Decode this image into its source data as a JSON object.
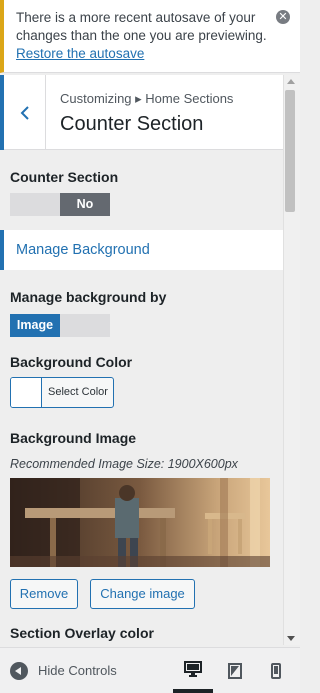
{
  "notice": {
    "text": "There is a more recent autosave of your changes than the one you are previewing.",
    "link": "Restore the autosave"
  },
  "header": {
    "breadcrumb": "Customizing ▸ Home Sections",
    "title": "Counter Section"
  },
  "controls": {
    "counter_section": {
      "label": "Counter Section",
      "value": "No"
    },
    "manage_background_panel": "Manage Background",
    "manage_background_by": {
      "label": "Manage background by",
      "value": "Image"
    },
    "background_color": {
      "label": "Background Color",
      "button": "Select Color"
    },
    "background_image": {
      "label": "Background Image",
      "hint": "Recommended Image Size: 1900X600px",
      "remove": "Remove",
      "change": "Change image"
    },
    "section_overlay": {
      "label": "Section Overlay color"
    }
  },
  "footer": {
    "hide_controls": "Hide Controls",
    "devices": [
      "desktop",
      "tablet",
      "mobile"
    ],
    "active_device": "desktop"
  },
  "colors": {
    "accent": "#2271b1",
    "toggle_on": "#646970",
    "notice_border": "#dba617"
  }
}
